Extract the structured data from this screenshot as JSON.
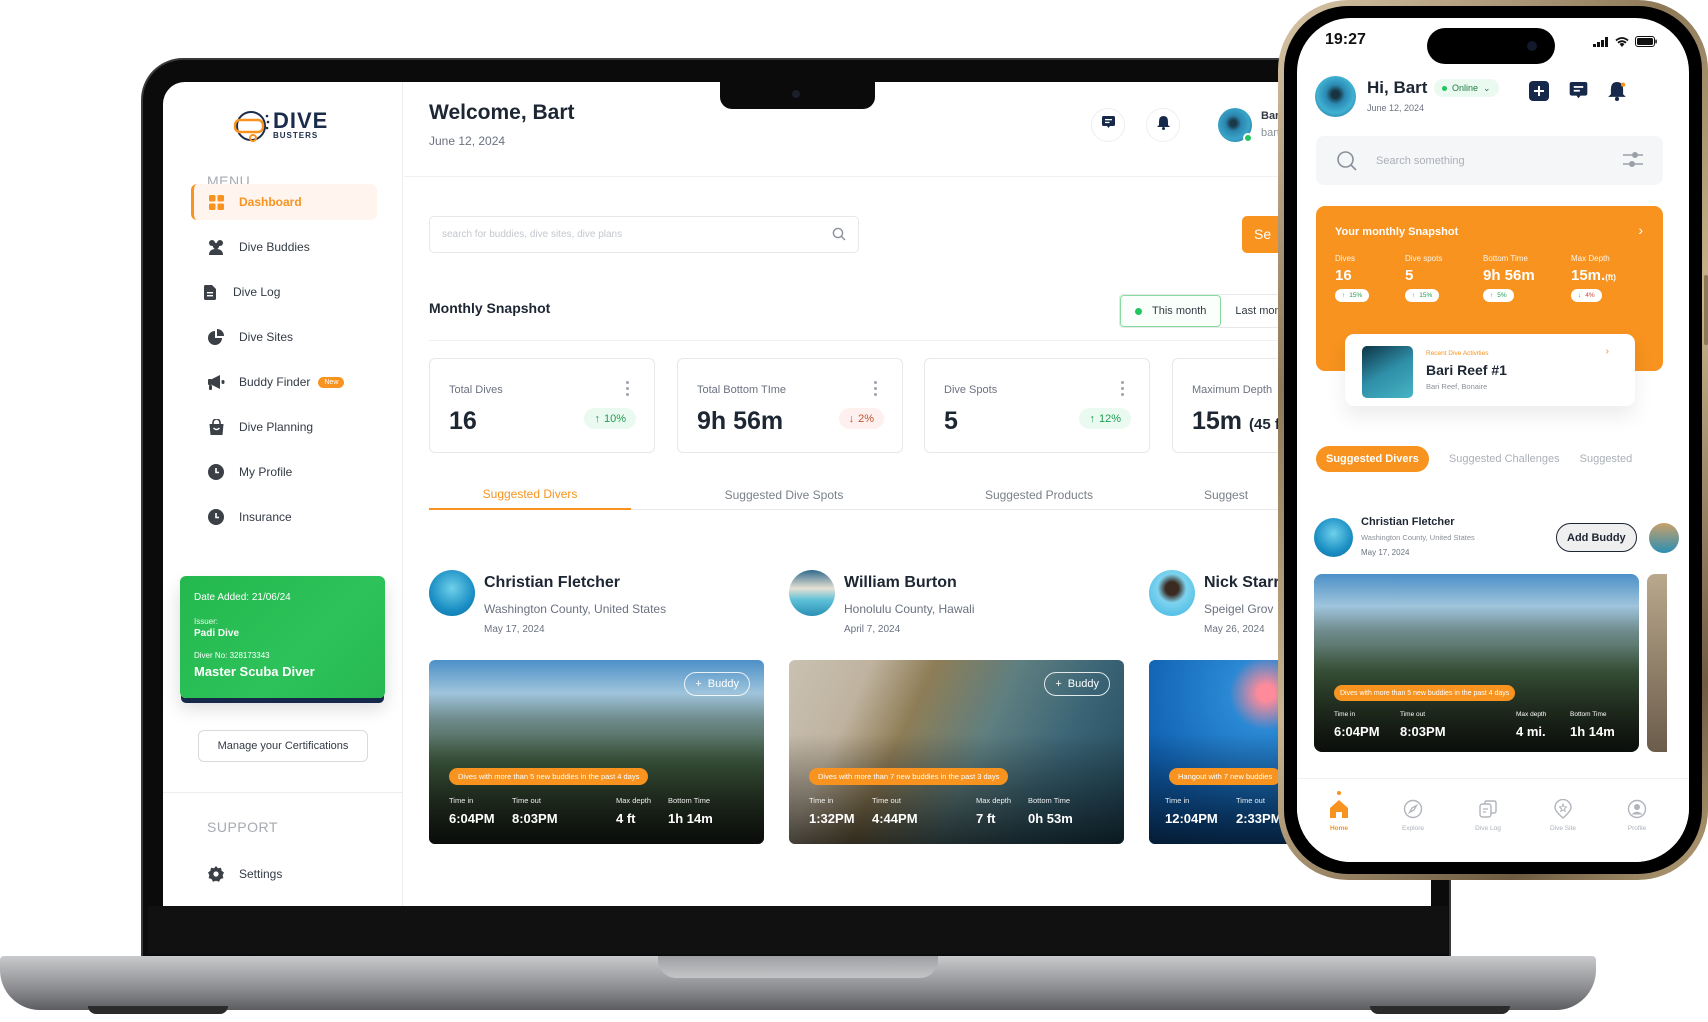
{
  "brand": {
    "name_line1": "DIVE",
    "name_line2": "BUSTERS",
    "accent": "#f7931e",
    "success": "#22c55e"
  },
  "sidebar": {
    "menu_label": "MENU",
    "items": [
      {
        "label": "Dashboard",
        "icon": "grid-icon",
        "active": true
      },
      {
        "label": "Dive Buddies",
        "icon": "users-icon"
      },
      {
        "label": "Dive Log",
        "icon": "document-icon"
      },
      {
        "label": "Dive Sites",
        "icon": "pie-chart-icon"
      },
      {
        "label": "Buddy Finder",
        "icon": "megaphone-icon",
        "badge": "New"
      },
      {
        "label": "Dive Planning",
        "icon": "bag-icon"
      },
      {
        "label": "My Profile",
        "icon": "clock-icon"
      },
      {
        "label": "Insurance",
        "icon": "clock-icon"
      }
    ],
    "certification": {
      "date_added": "Date Added: 21/06/24",
      "issuer_label": "Issuer:",
      "issuer": "Padi Dive",
      "diver_no": "Diver No: 328173343",
      "title": "Master Scuba Diver"
    },
    "manage_cert_label": "Manage your Certifications",
    "support_label": "SUPPORT",
    "settings_label": "Settings"
  },
  "header": {
    "welcome": "Welcome, Bart",
    "date": "June 12, 2024",
    "user_name": "Bart",
    "user_email": "bart"
  },
  "search": {
    "placeholder": "search for buddies, dive sites, dive plans",
    "button_label": "Se"
  },
  "snapshot": {
    "title": "Monthly Snapshot",
    "period_options": [
      "This month",
      "Last month"
    ],
    "selected_period": "This month",
    "stats": [
      {
        "label": "Total Dives",
        "value": "16",
        "change": "10%",
        "direction": "up"
      },
      {
        "label": "Total Bottom TIme",
        "value": "9h 56m",
        "change": "2%",
        "direction": "down"
      },
      {
        "label": "Dive Spots",
        "value": "5",
        "change": "12%",
        "direction": "up"
      },
      {
        "label": "Maximum Depth",
        "value": "15m",
        "value_suffix": "(45 f"
      }
    ]
  },
  "tabs": [
    "Suggested Divers",
    "Suggested Dive Spots",
    "Suggested Products",
    "Suggest"
  ],
  "active_tab": "Suggested Divers",
  "divers": [
    {
      "name": "Christian Fletcher",
      "location": "Washington County, United States",
      "date": "May 17, 2024",
      "buddy_label": "Buddy",
      "highlight": "Dives with more than 5 new buddies in the past 4 days",
      "time_in_label": "Time in",
      "time_in": "6:04PM",
      "time_out_label": "Time out",
      "time_out": "8:03PM",
      "max_depth_label": "Max depth",
      "max_depth": "4 ft",
      "bottom_time_label": "Bottom Time",
      "bottom_time": "1h 14m"
    },
    {
      "name": "William Burton",
      "location": "Honolulu County, Hawali",
      "date": "April 7, 2024",
      "buddy_label": "Buddy",
      "highlight": "Dives with more than 7 new buddies in the past 3 days",
      "time_in_label": "Time in",
      "time_in": "1:32PM",
      "time_out_label": "Time out",
      "time_out": "4:44PM",
      "max_depth_label": "Max depth",
      "max_depth": "7 ft",
      "bottom_time_label": "Bottom Time",
      "bottom_time": "0h 53m"
    },
    {
      "name": "Nick Starr",
      "location": "Speigel Grov",
      "date": "May 26, 2024",
      "highlight": "Hangout with 7 new buddies",
      "time_in_label": "Time in",
      "time_in": "12:04PM",
      "time_out_label": "Time out",
      "time_out": "2:33PM"
    }
  ],
  "phone": {
    "time": "19:27",
    "greeting": "Hi, Bart",
    "status": "Online",
    "date": "June 12, 2024",
    "search_placeholder": "Search something",
    "snapshot": {
      "title": "Your monthly Snapshot",
      "stats": [
        {
          "label": "Dives",
          "value": "16",
          "change": "15%",
          "direction": "up"
        },
        {
          "label": "Dive spots",
          "value": "5",
          "change": "15%",
          "direction": "up"
        },
        {
          "label": "Bottom Time",
          "value": "9h 56m",
          "change": "5%",
          "direction": "up"
        },
        {
          "label": "Max Depth",
          "value": "15m.",
          "unit": "(ft)",
          "change": "4%",
          "direction": "down"
        }
      ]
    },
    "recent": {
      "kicker": "Recent Dive Activities",
      "name": "Bari Reef #1",
      "location": "Bari Reef, Bonaire"
    },
    "tabs": [
      "Suggested Divers",
      "Suggested Challenges",
      "Suggested"
    ],
    "diver": {
      "name": "Christian Fletcher",
      "location": "Washington County, United States",
      "date": "May 17, 2024",
      "add_label": "Add Buddy",
      "highlight": "Dives with more than 5 new buddies in the past 4 days",
      "time_in_label": "Time in",
      "time_in": "6:04PM",
      "time_out_label": "Time out",
      "time_out": "8:03PM",
      "max_depth_label": "Max depth",
      "max_depth": "4 mi.",
      "bottom_time_label": "Bottom Time",
      "bottom_time": "1h 14m"
    },
    "nav": [
      {
        "label": "Home",
        "icon": "home-icon",
        "active": true
      },
      {
        "label": "Explore",
        "icon": "compass-icon"
      },
      {
        "label": "Dive Log",
        "icon": "dive-log-icon"
      },
      {
        "label": "Dive Site",
        "icon": "location-pin-icon"
      },
      {
        "label": "Profile",
        "icon": "profile-icon"
      }
    ]
  }
}
